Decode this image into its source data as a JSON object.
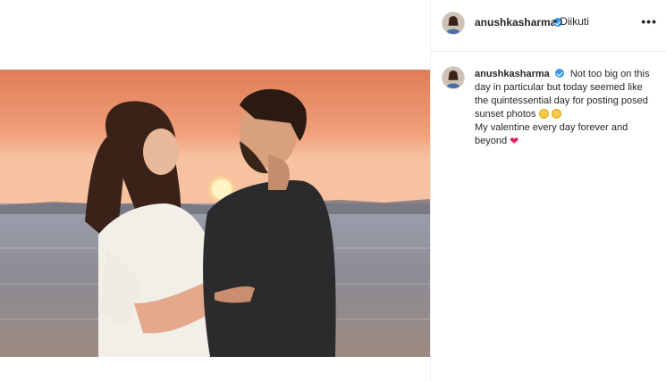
{
  "header": {
    "username": "anushkasharma",
    "follow_label": "Diikuti",
    "dot": "•",
    "more": "•••"
  },
  "caption": {
    "username": "anushkasharma",
    "text_line1": "Not too big on this day in particular but today seemed like the quintessential day for posting posed sunset photos",
    "text_line2": "My valentine every day forever and beyond",
    "emojis": [
      "pleading-face-emoji",
      "grinning-squint-emoji",
      "red-heart-emoji"
    ]
  },
  "colors": {
    "verified": "#3897f0",
    "sky_top": "#e4865a",
    "sky_horizon": "#f6b68a",
    "sea": "#7b7a86",
    "heart": "#e0245e"
  }
}
